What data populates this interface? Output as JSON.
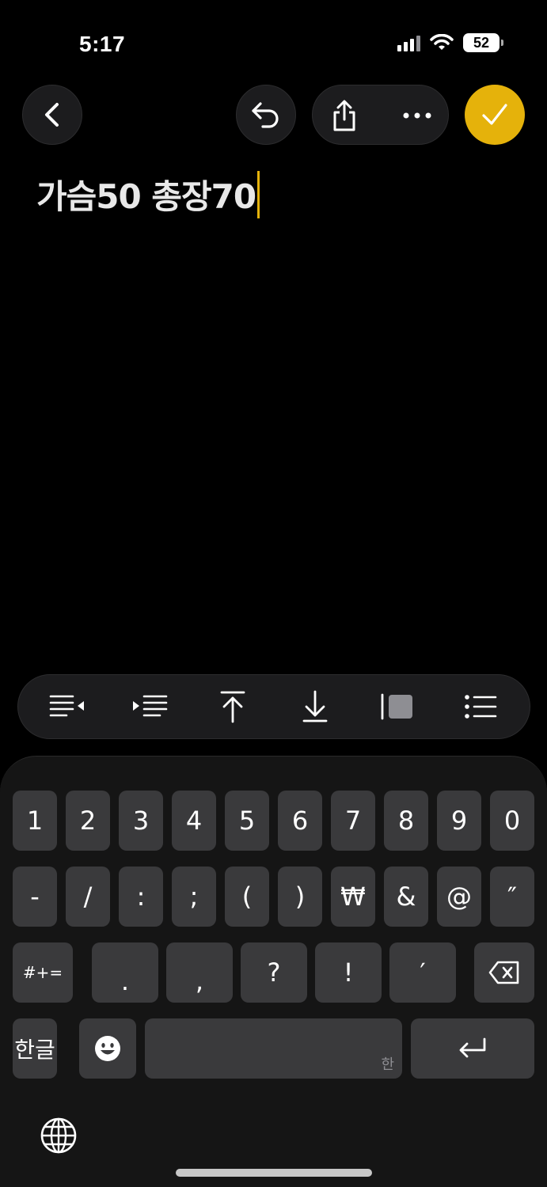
{
  "status": {
    "time": "5:17",
    "battery": "52"
  },
  "note": {
    "text": "가슴50 총장70"
  },
  "keyboard": {
    "row1": [
      "1",
      "2",
      "3",
      "4",
      "5",
      "6",
      "7",
      "8",
      "9",
      "0"
    ],
    "row2": [
      "-",
      "/",
      ":",
      ";",
      "(",
      ")",
      "₩",
      "&",
      "@",
      "″"
    ],
    "row3": [
      "#+=",
      ".",
      ",",
      "?",
      "!",
      "′"
    ],
    "hangul_label": "한글",
    "space_hint": "한"
  },
  "colors": {
    "accent": "#e5b20b",
    "key": "#3a3a3c",
    "bar": "#1c1c1e"
  },
  "icons": {
    "back": "chevron-left-icon",
    "undo": "undo-icon",
    "share": "share-icon",
    "more": "ellipsis-icon",
    "done": "checkmark-icon",
    "format": [
      "outdent-icon",
      "indent-icon",
      "move-up-icon",
      "move-down-icon",
      "block-quote-icon",
      "list-icon"
    ],
    "delete": "delete-icon",
    "emoji": "emoji-icon",
    "return": "return-icon",
    "globe": "globe-icon"
  }
}
